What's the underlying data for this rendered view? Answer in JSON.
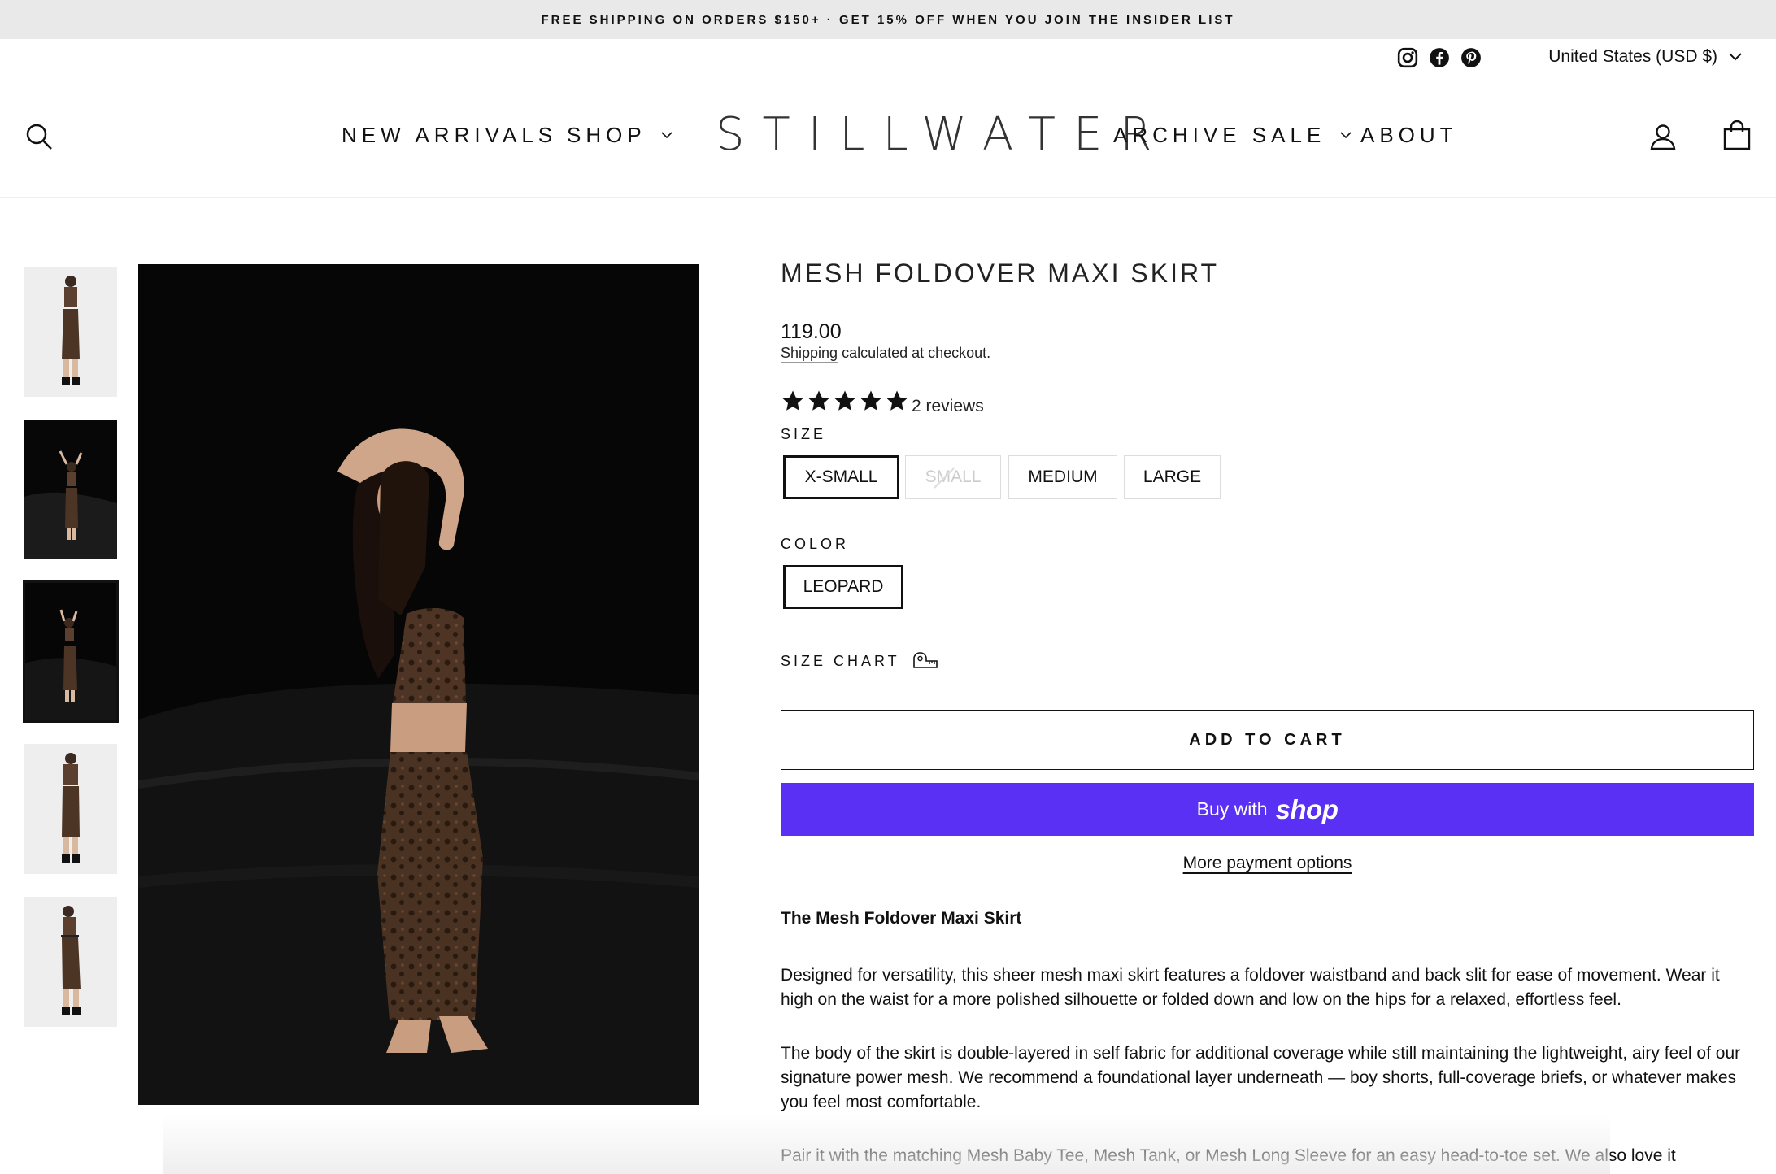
{
  "announcement": "FREE SHIPPING ON ORDERS $150+ · GET 15% OFF WHEN YOU JOIN THE INSIDER LIST",
  "utility": {
    "social_icons": [
      "instagram-icon",
      "facebook-icon",
      "pinterest-icon"
    ],
    "country": "United States (USD $)"
  },
  "nav": {
    "brand": "STILLWATER",
    "left": [
      "NEW ARRIVALS",
      "SHOP"
    ],
    "right": [
      "ARCHIVE SALE",
      "ABOUT"
    ],
    "icons": [
      "search-icon",
      "account-icon",
      "cart-icon"
    ]
  },
  "product": {
    "title": "MESH FOLDOVER MAXI SKIRT",
    "price": "119.00",
    "shipping_link": "Shipping",
    "shipping_rest": " calculated at checkout.",
    "rating": 5,
    "reviews": "2 reviews",
    "size_label": "SIZE",
    "sizes": [
      "X-SMALL",
      "SMALL",
      "MEDIUM",
      "LARGE"
    ],
    "color_label": "COLOR",
    "colors": [
      "LEOPARD"
    ],
    "size_chart": "SIZE CHART",
    "add_to_cart": "ADD TO CART",
    "buy_with": "Buy with",
    "shop_brand": "shop",
    "more_payment": "More payment options",
    "desc_title": "The Mesh Foldover Maxi Skirt",
    "para1": "Designed for versatility, this sheer mesh maxi skirt features a foldover waistband and back slit for ease of movement. Wear it high on the waist for a more polished silhouette or folded down and low on the hips for a relaxed, effortless feel.",
    "para2": "The body of the skirt is double-layered in self fabric for additional coverage while still maintaining the lightweight, airy feel of our signature power mesh. We recommend a foundational layer underneath — boy shorts, full-coverage briefs, or whatever makes you feel most comfortable.",
    "para3": "Pair it with the matching Mesh Baby Tee, Mesh Tank, or Mesh Long Sleeve for an easy head-to-toe set. We also love it"
  },
  "colors": {
    "shop_pay": "#5a31f4",
    "text": "#111111",
    "announce_bg": "#e9e9e9"
  }
}
